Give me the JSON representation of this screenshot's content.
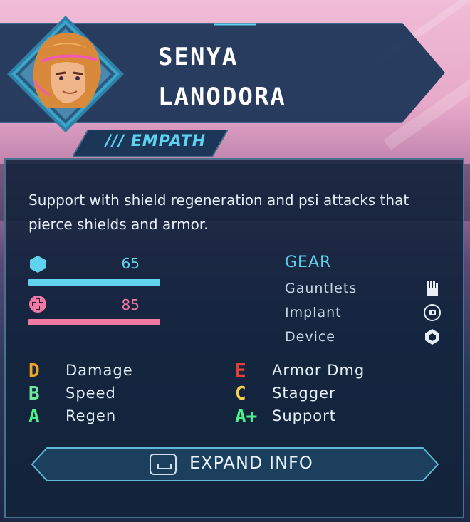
{
  "character": {
    "first_name": "SENYA",
    "last_name": "LANODORA",
    "class_label": "/// EMPATH",
    "description": "Support with shield regeneration and psi attacks that pierce shields and armor."
  },
  "stats": {
    "shield": {
      "value": "65",
      "icon": "shield-hexagon-icon",
      "color": "#5fd3ee"
    },
    "health": {
      "value": "85",
      "icon": "health-cross-icon",
      "color": "#f07aa4"
    }
  },
  "gear": {
    "title": "GEAR",
    "items": [
      {
        "label": "Gauntlets",
        "icon": "gauntlet-icon"
      },
      {
        "label": "Implant",
        "icon": "implant-icon"
      },
      {
        "label": "Device",
        "icon": "device-icon"
      }
    ]
  },
  "ratings": [
    {
      "grade": "D",
      "label": "Damage",
      "color": "#f5a623"
    },
    {
      "grade": "B",
      "label": "Speed",
      "color": "#6fe8a0"
    },
    {
      "grade": "A",
      "label": "Regen",
      "color": "#4ef08a"
    },
    {
      "grade": "E",
      "label": "Armor Dmg",
      "color": "#e8413a"
    },
    {
      "grade": "C",
      "label": "Stagger",
      "color": "#f2d04a"
    },
    {
      "grade": "A+",
      "label": "Support",
      "color": "#4ef08a"
    }
  ],
  "expand_button": {
    "label": "EXPAND INFO"
  },
  "colors": {
    "accent": "#5fd3ee",
    "panel": "#11223a",
    "banner": "#1c3658"
  }
}
